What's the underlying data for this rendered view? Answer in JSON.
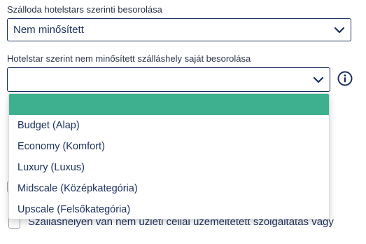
{
  "classification_field": {
    "label": "Szálloda hotelstars szerinti besorolása",
    "value": "Nem minősített"
  },
  "own_classification_field": {
    "label": "Hotelstar szerint nem minősített szálláshely saját besorolása",
    "value": "",
    "info_icon": "info-circle-icon"
  },
  "dropdown": {
    "options": [
      "",
      "Budget (Alap)",
      "Economy (Komfort)",
      "Luxury (Luxus)",
      "Midscale (Középkategória)",
      "Upscale (Felsőkategória)"
    ],
    "highlight_color": "#3fb08f"
  },
  "background_checkbox": {
    "label": "Szálláshelyen van nem üzleti céllal üzemeltetett szolgáltatás vagy"
  }
}
